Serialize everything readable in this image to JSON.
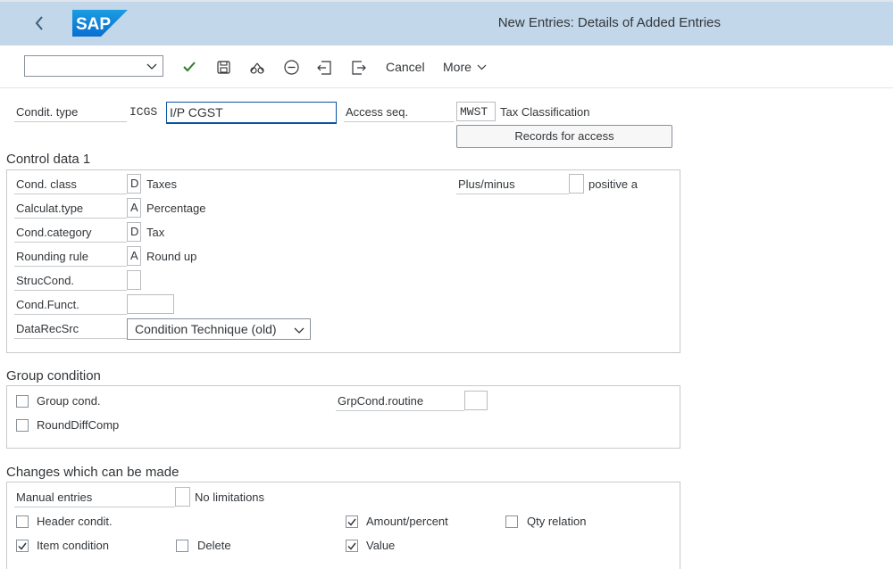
{
  "header": {
    "title": "New Entries: Details of Added Entries",
    "logo_text": "SAP",
    "brand_color": "#0a6ed1"
  },
  "toolbar": {
    "command_value": "",
    "cancel_label": "Cancel",
    "more_label": "More",
    "icons": [
      "check-icon",
      "save-icon",
      "glasses-icon",
      "minus-circle-icon",
      "previous-entry-icon",
      "next-entry-icon"
    ]
  },
  "condition": {
    "type_label": "Condit. type",
    "type_code": "ICGS",
    "type_name": "I/P CGST",
    "access_label": "Access seq.",
    "access_code": "MWST",
    "access_text": "Tax Classification",
    "records_button": "Records for access"
  },
  "control": {
    "title": "Control data 1",
    "class_label": "Cond. class",
    "class_code": "D",
    "class_text": "Taxes",
    "calc_label": "Calculat.type",
    "calc_code": "A",
    "calc_text": "Percentage",
    "category_label": "Cond.category",
    "category_code": "D",
    "category_text": "Tax",
    "rounding_label": "Rounding rule",
    "rounding_code": "A",
    "rounding_text": "Round up",
    "struc_label": "StrucCond.",
    "struc_value": "",
    "funct_label": "Cond.Funct.",
    "funct_value": "",
    "datarec_label": "DataRecSrc",
    "datarec_value": "Condition Technique (old)",
    "plusminus_label": "Plus/minus",
    "plusminus_value": "",
    "plusminus_text": "positive a"
  },
  "group": {
    "title": "Group condition",
    "group_cond_label": "Group cond.",
    "group_cond_checked": false,
    "round_diff_label": "RoundDiffComp",
    "round_diff_checked": false,
    "routine_label": "GrpCond.routine",
    "routine_value": ""
  },
  "changes": {
    "title": "Changes which can be made",
    "manual_label": "Manual entries",
    "manual_value": "",
    "manual_text": "No limitations",
    "header_label": "Header condit.",
    "header_checked": false,
    "amount_label": "Amount/percent",
    "amount_checked": true,
    "qty_label": "Qty relation",
    "qty_checked": false,
    "item_label": "Item condition",
    "item_checked": true,
    "delete_label": "Delete",
    "delete_checked": false,
    "value_label": "Value",
    "value_checked": true
  }
}
